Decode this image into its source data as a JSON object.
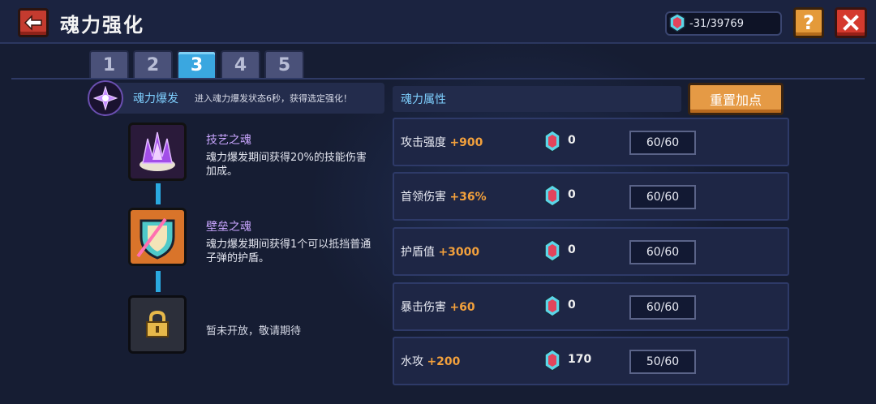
{
  "header": {
    "title": "魂力强化",
    "currency_value": "-31/39769"
  },
  "tabs": [
    {
      "label": "1"
    },
    {
      "label": "2"
    },
    {
      "label": "3"
    },
    {
      "label": "4"
    },
    {
      "label": "5"
    }
  ],
  "active_tab": "3",
  "burst": {
    "title": "魂力爆发",
    "description": "进入魂力爆发状态6秒，获得选定强化！"
  },
  "skills": [
    {
      "name": "技艺之魂",
      "description": "魂力爆发期间获得20%的技能伤害加成。"
    },
    {
      "name": "壁垒之魂",
      "description": "魂力爆发期间获得1个可以抵挡普通子弹的护盾。"
    }
  ],
  "locked": {
    "text": "暂未开放，敬请期待"
  },
  "attributes": {
    "header": "魂力属性",
    "reset_label": "重置加点",
    "rows": [
      {
        "label": "攻击强度",
        "bonus": "+900",
        "count": "0",
        "level": "60/60"
      },
      {
        "label": "首领伤害",
        "bonus": "+36%",
        "count": "0",
        "level": "60/60"
      },
      {
        "label": "护盾值",
        "bonus": "+3000",
        "count": "0",
        "level": "60/60"
      },
      {
        "label": "暴击伤害",
        "bonus": "+60",
        "count": "0",
        "level": "60/60"
      },
      {
        "label": "水攻",
        "bonus": "+200",
        "count": "170",
        "level": "50/60"
      }
    ]
  },
  "colors": {
    "accent_blue": "#3aa7e0",
    "accent_orange": "#e59a45",
    "bonus_orange": "#f2a03c",
    "close_red": "#d43a2e"
  },
  "icons": [
    "back-arrow-icon",
    "gem-icon",
    "help-icon",
    "close-icon",
    "burst-star-icon",
    "crystal-icon",
    "shield-sword-icon",
    "lock-icon"
  ]
}
